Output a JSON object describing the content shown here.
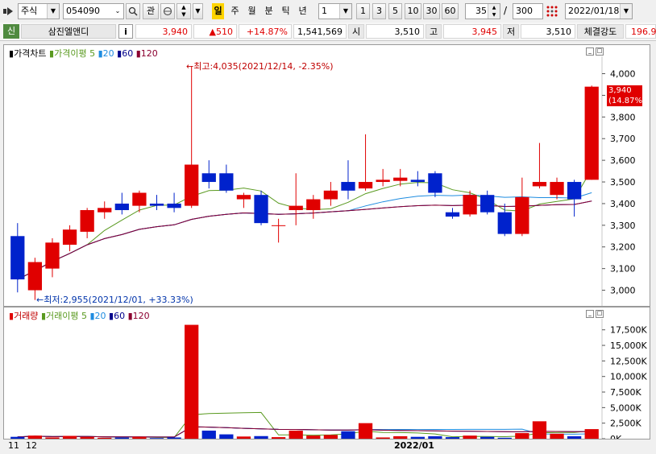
{
  "toolbar": {
    "menu_icon": "arrow-menu-icon",
    "market_type": "주식",
    "code": "054090",
    "search_icon": "search-icon",
    "gwan": "관",
    "intervals": [
      "일",
      "주",
      "월",
      "분",
      "틱",
      "년"
    ],
    "active_interval": "일",
    "period_value": "1",
    "quick_periods": [
      "1",
      "3",
      "5",
      "10",
      "30",
      "60"
    ],
    "display_count": "35",
    "slash": "/",
    "total_count": "300",
    "date": "2022/01/18"
  },
  "quote": {
    "badge": "신",
    "name": "삼진엘앤디",
    "info_icon": "i",
    "price": "3,940",
    "change": "▲510",
    "change_pct": "+14.87%",
    "volume": "1,541,569",
    "open_label": "시",
    "open": "3,510",
    "high_label": "고",
    "high": "3,945",
    "low_label": "저",
    "low": "3,510",
    "strength_label": "체결강도",
    "strength": "196.9"
  },
  "price_panel": {
    "title": "가격차트",
    "ma_label": "가격이평",
    "ma_periods": [
      "5",
      "20",
      "60",
      "120"
    ],
    "ma_colors": [
      "#5a9a20",
      "#1e8ce0",
      "#00008b",
      "#8b0030"
    ],
    "y_ticks": [
      "4,000",
      "3,900",
      "3,800",
      "3,700",
      "3,600",
      "3,500",
      "3,400",
      "3,300",
      "3,200",
      "3,100",
      "3,000"
    ],
    "current_label": "3,940",
    "current_pct_label": "(14.87%)",
    "max_annotation": "←최고:4,035(2021/12/14, -2.35%)",
    "min_annotation": "←최저:2,955(2021/12/01, +33.33%)"
  },
  "volume_panel": {
    "title": "거래량",
    "ma_label": "거래이평",
    "ma_periods": [
      "5",
      "20",
      "60",
      "120"
    ],
    "y_ticks": [
      "17,500K",
      "15,000K",
      "12,500K",
      "10,000K",
      "7,500K",
      "5,000K",
      "2,500K",
      "0K"
    ]
  },
  "x_axis": {
    "month_labels": [
      "11",
      "12"
    ],
    "year_label": "2022/01"
  },
  "chart_data": {
    "type": "candlestick",
    "ylim": [
      2950,
      4080
    ],
    "volume_ylim": [
      0,
      18500
    ],
    "up_color": "#e00000",
    "down_color": "#0022cc",
    "candles": [
      {
        "o": 3250,
        "h": 3310,
        "l": 2990,
        "c": 3050,
        "v": 300
      },
      {
        "o": 3000,
        "h": 3150,
        "l": 2955,
        "c": 3130,
        "v": 500
      },
      {
        "o": 3100,
        "h": 3240,
        "l": 3060,
        "c": 3220,
        "v": 200
      },
      {
        "o": 3210,
        "h": 3300,
        "l": 3180,
        "c": 3280,
        "v": 450
      },
      {
        "o": 3270,
        "h": 3380,
        "l": 3240,
        "c": 3370,
        "v": 280
      },
      {
        "o": 3360,
        "h": 3410,
        "l": 3330,
        "c": 3380,
        "v": 150
      },
      {
        "o": 3400,
        "h": 3450,
        "l": 3350,
        "c": 3370,
        "v": 180
      },
      {
        "o": 3390,
        "h": 3460,
        "l": 3360,
        "c": 3450,
        "v": 320
      },
      {
        "o": 3400,
        "h": 3440,
        "l": 3370,
        "c": 3390,
        "v": 100
      },
      {
        "o": 3400,
        "h": 3450,
        "l": 3360,
        "c": 3380,
        "v": 200
      },
      {
        "o": 3390,
        "h": 4035,
        "l": 3380,
        "c": 3580,
        "v": 18300
      },
      {
        "o": 3540,
        "h": 3600,
        "l": 3470,
        "c": 3500,
        "v": 1300
      },
      {
        "o": 3540,
        "h": 3580,
        "l": 3450,
        "c": 3460,
        "v": 700
      },
      {
        "o": 3420,
        "h": 3450,
        "l": 3380,
        "c": 3440,
        "v": 350
      },
      {
        "o": 3440,
        "h": 3460,
        "l": 3300,
        "c": 3310,
        "v": 420
      },
      {
        "o": 3300,
        "h": 3330,
        "l": 3220,
        "c": 3300,
        "v": 250
      },
      {
        "o": 3370,
        "h": 3540,
        "l": 3300,
        "c": 3390,
        "v": 1300
      },
      {
        "o": 3370,
        "h": 3440,
        "l": 3330,
        "c": 3420,
        "v": 500
      },
      {
        "o": 3420,
        "h": 3500,
        "l": 3390,
        "c": 3460,
        "v": 600
      },
      {
        "o": 3500,
        "h": 3600,
        "l": 3420,
        "c": 3460,
        "v": 1200
      },
      {
        "o": 3470,
        "h": 3720,
        "l": 3460,
        "c": 3500,
        "v": 2500
      },
      {
        "o": 3500,
        "h": 3560,
        "l": 3480,
        "c": 3510,
        "v": 200
      },
      {
        "o": 3505,
        "h": 3560,
        "l": 3480,
        "c": 3520,
        "v": 400
      },
      {
        "o": 3510,
        "h": 3550,
        "l": 3480,
        "c": 3500,
        "v": 300
      },
      {
        "o": 3540,
        "h": 3550,
        "l": 3430,
        "c": 3450,
        "v": 400
      },
      {
        "o": 3360,
        "h": 3380,
        "l": 3330,
        "c": 3340,
        "v": 250
      },
      {
        "o": 3350,
        "h": 3460,
        "l": 3340,
        "c": 3440,
        "v": 500
      },
      {
        "o": 3440,
        "h": 3460,
        "l": 3350,
        "c": 3360,
        "v": 300
      },
      {
        "o": 3360,
        "h": 3400,
        "l": 3250,
        "c": 3260,
        "v": 150
      },
      {
        "o": 3260,
        "h": 3520,
        "l": 3250,
        "c": 3430,
        "v": 900
      },
      {
        "o": 3480,
        "h": 3680,
        "l": 3470,
        "c": 3500,
        "v": 2800
      },
      {
        "o": 3440,
        "h": 3520,
        "l": 3420,
        "c": 3500,
        "v": 800
      },
      {
        "o": 3500,
        "h": 3510,
        "l": 3340,
        "c": 3420,
        "v": 400
      },
      {
        "o": 3510,
        "h": 3945,
        "l": 3510,
        "c": 3940,
        "v": 1541
      }
    ]
  }
}
